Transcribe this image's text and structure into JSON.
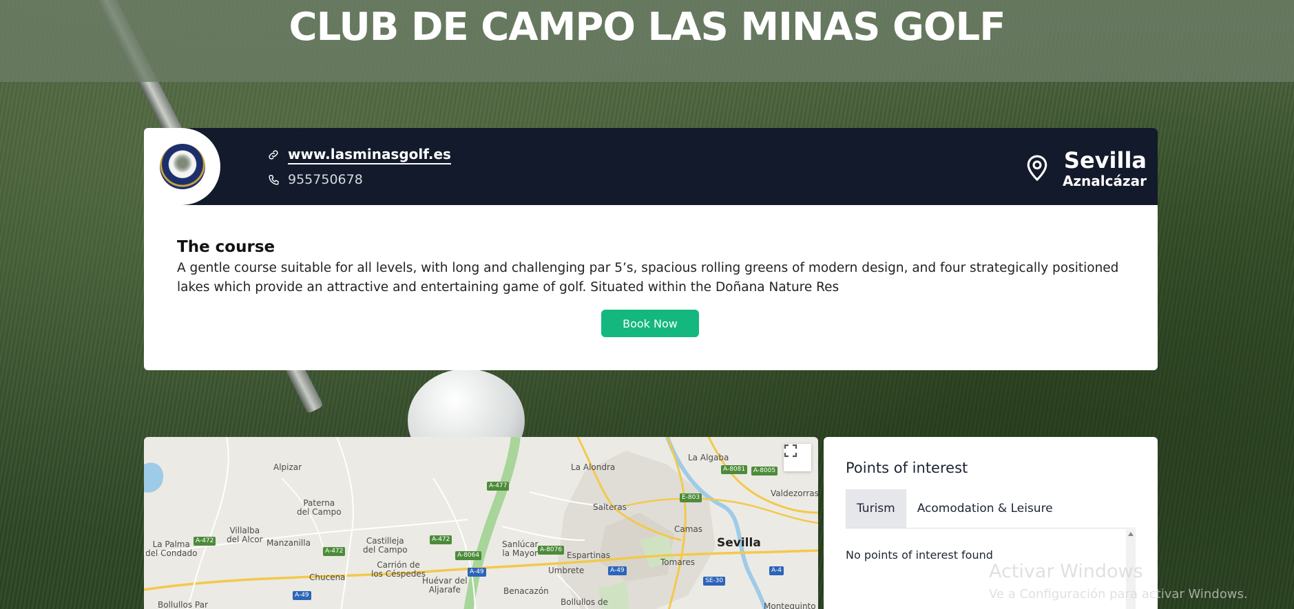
{
  "page": {
    "title": "CLUB DE CAMPO LAS MINAS GOLF"
  },
  "club": {
    "logo_icon": "club-crest-logo",
    "website": "www.lasminasgolf.es",
    "phone": "955750678",
    "city": "Sevilla",
    "town": "Aznalcázar"
  },
  "course": {
    "title": "The course",
    "description": "A gentle course suitable for all levels, with long and challenging par 5’s, spacious rolling greens of modern design, and four strategically positioned lakes which provide an attractive and entertaining game of golf. Situated within the Doñana Nature Res",
    "book_label": "Book Now"
  },
  "map": {
    "labels": {
      "alpizar": "Alpizar",
      "paterna": "Paterna\ndel Campo",
      "villalba": "Villalba\ndel Alcor",
      "la_palma": "La Palma\ndel Condado",
      "manzanilla": "Manzanilla",
      "castilleja": "Castilleja\ndel Campo",
      "carrion": "Carrión de\nlos Céspedes",
      "chucena": "Chucena",
      "huevar": "Huévar del\nAljarafe",
      "sanlucar": "Sanlúcar\nla Mayor",
      "espartinas": "Espartinas",
      "umbrete": "Umbrete",
      "benacazon": "Benacazón",
      "bollullos_par": "Bollullos Par",
      "bollullos_mitacion": "Bollullos de",
      "la_alondra": "La Alondra",
      "salteras": "Salteras",
      "camas": "Camas",
      "tomares": "Tomares",
      "sevilla": "Sevilla",
      "la_algaba": "La Algaba",
      "valdezorras": "Valdezorras",
      "montequinto": "Montequinto"
    },
    "roads": {
      "a477": "A-477",
      "a472a": "A-472",
      "a472b": "A-472",
      "a472c": "A-472",
      "a8064": "A-8064",
      "a8076": "A-8076",
      "a49a": "A-49",
      "a49b": "A-49",
      "a49c": "A-49",
      "e803": "E-803",
      "a8081": "A-8081",
      "a8005": "A-8005",
      "a4": "A-4",
      "se30": "SE-30"
    },
    "fullscreen_icon": "fullscreen-icon"
  },
  "poi": {
    "title": "Points of interest",
    "tabs": [
      "Turism",
      "Acomodation & Leisure"
    ],
    "active_tab": "Turism",
    "empty_text": "No points of interest found"
  },
  "watermark": {
    "title": "Activar Windows",
    "subtitle": "Ve a Configuración para activar Windows."
  },
  "colors": {
    "header_band": "#6c7d67",
    "card_bar": "#131a2b",
    "book_button": "#14b87e",
    "map_background": "#eceae4"
  }
}
